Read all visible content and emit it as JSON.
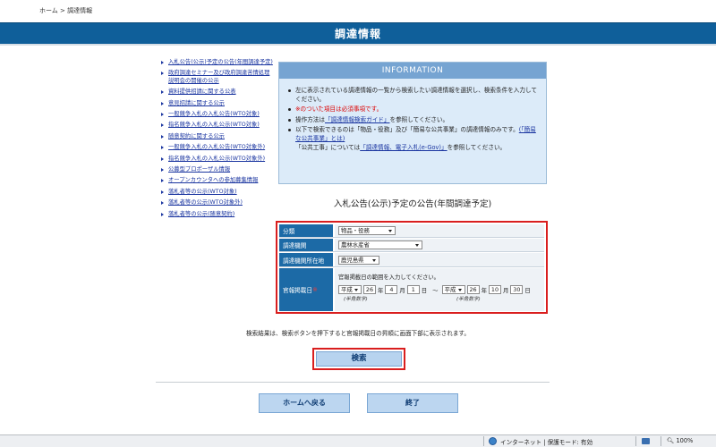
{
  "breadcrumb": {
    "home": "ホーム",
    "sep": ">",
    "current": "調達情報"
  },
  "banner": {
    "title": "調達情報"
  },
  "sidebar": {
    "items": [
      {
        "label": "入札公告(公示)予定の公告(年間調達予定)"
      },
      {
        "label": "政府調達セミナー及び政府調達苦情処理説明会の開催の公示"
      },
      {
        "label": "資料提供招請に関する公表"
      },
      {
        "label": "意見招請に関する公示"
      },
      {
        "label": "一般競争入札の入札公告(WTO対象)"
      },
      {
        "label": "指名競争入札の入札公示(WTO対象)"
      },
      {
        "label": "随意契約に関する公示"
      },
      {
        "label": "一般競争入札の入札公告(WTO対象外)"
      },
      {
        "label": "指名競争入札の入札公示(WTO対象外)"
      },
      {
        "label": "公募型プロポーザル情報"
      },
      {
        "label": "オープンカウンタへの参加募集情報"
      },
      {
        "label": "落札者等の公示(WTO対象)"
      },
      {
        "label": "落札者等の公示(WTO対象外)"
      },
      {
        "label": "落札者等の公示(随意契約)"
      }
    ]
  },
  "info": {
    "header": "INFORMATION",
    "line1": "左に表示されている調達情報の一覧から検索したい調達情報を選択し、検索条件を入力してください。",
    "line2": "※のついた項目は必須事項です。",
    "line3_pre": "操作方法は",
    "line3_link": "「調達情報検索ガイド」",
    "line3_post": "を参照してください。",
    "line4": "以下で検索できるのは「物品・役務」及び「簡易な公共事業」の調達情報のみです。",
    "line4_link": "(「簡易な公共事業」とは)",
    "line5_pre": "「公共工事」については",
    "line5_link": "「調達情報、電子入札(e-Gov)」",
    "line5_post": "を参照してください。"
  },
  "form": {
    "title": "入札公告(公示)予定の公告(年間調達予定)",
    "rows": {
      "category": {
        "label": "分類",
        "value": "物品・役務"
      },
      "agency": {
        "label": "調達機関",
        "value": "農林水産省"
      },
      "location": {
        "label": "調達機関所在地",
        "value": "鹿児島県"
      },
      "date": {
        "label": "官報掲載日",
        "required": "※",
        "instruction": "官報掲載日の範囲を入力してください。",
        "from": {
          "era": "平成",
          "year": "26",
          "month": "4",
          "day": "1"
        },
        "to": {
          "era": "平成",
          "year": "26",
          "month": "10",
          "day": "30"
        },
        "unit_year": "年",
        "unit_month": "月",
        "unit_day": "日",
        "tilde": "～",
        "hint": "(半角数字)"
      }
    }
  },
  "note": "検索結果は、検索ボタンを押下すると官報掲載日の昇順に画面下部に表示されます。",
  "buttons": {
    "search": "検索",
    "home": "ホームへ戻る",
    "exit": "終了"
  },
  "statusbar": {
    "zone": "インターネット | 保護モード: 有効",
    "zoom": "100%"
  }
}
